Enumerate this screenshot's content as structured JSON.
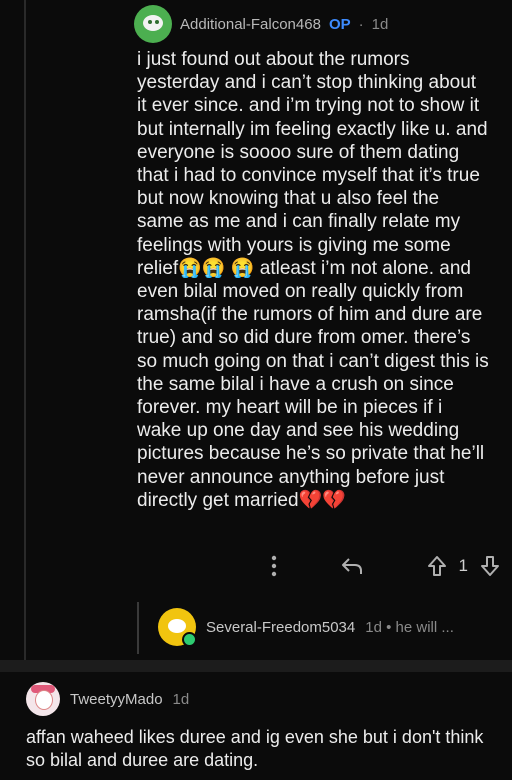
{
  "comment": {
    "username": "Additional-Falcon468",
    "op_badge": "OP",
    "separator": "·",
    "age": "1d",
    "body_1": "i just found out about the rumors yesterday and i can’t stop thinking about it ever since. and i’m trying not to show it but internally im feeling exactly like u. and everyone is soooo sure of them dating that i had to convince myself that it’s true but now knowing that u also feel the same as me and i can finally relate my feelings with yours is giving me some relief",
    "emoji_1": "😭😭",
    "emoji_2": "😭",
    "body_2": " atleast i’m not alone. and even bilal moved on really quickly from ramsha(if the rumors of him and dure are true) and so did dure from omer. there’s so much going on that i can’t digest this is the same bilal i have a crush on since forever. my heart will be in pieces if i wake up one day and see his wedding pictures because he’s so private that he’ll never announce anything before just directly get married",
    "emoji_3": "💔💔",
    "vote_count": "1"
  },
  "reply": {
    "username": "Several-Freedom5034",
    "meta": "1d • he will ..."
  },
  "second_comment": {
    "username": "TweetyyMado",
    "age": "1d",
    "body": "affan waheed likes duree and ig even she but i don't think so bilal and duree are dating."
  },
  "colors": {
    "background": "#0b0b0b",
    "op_blue": "#3d8bfd",
    "falcon_avatar": "#4caf50",
    "reply_avatar": "#f1c40f",
    "online_dot": "#2ecc71"
  },
  "icons": {
    "more": "more-vertical-icon",
    "reply": "reply-arrow-icon",
    "upvote": "upvote-arrow-icon",
    "downvote": "downvote-arrow-icon"
  }
}
